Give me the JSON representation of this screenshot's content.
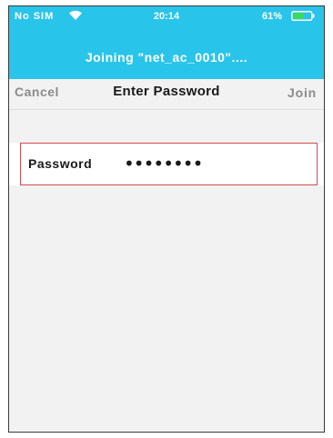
{
  "status_bar": {
    "carrier": "No SIM",
    "wifi_icon": "wifi-icon",
    "time": "20:14",
    "battery_percent": "61%",
    "battery_icon": "battery-icon",
    "battery_level": 0.61
  },
  "header": {
    "title": "Joining \"net_ac_0010\"...."
  },
  "nav": {
    "cancel_label": "Cancel",
    "title": "Enter Password",
    "join_label": "Join"
  },
  "form": {
    "password_label": "Password",
    "password_value": "••••••••"
  },
  "colors": {
    "accent": "#29c4ea",
    "field_border": "#d6484f",
    "background": "#f2f2f3"
  }
}
